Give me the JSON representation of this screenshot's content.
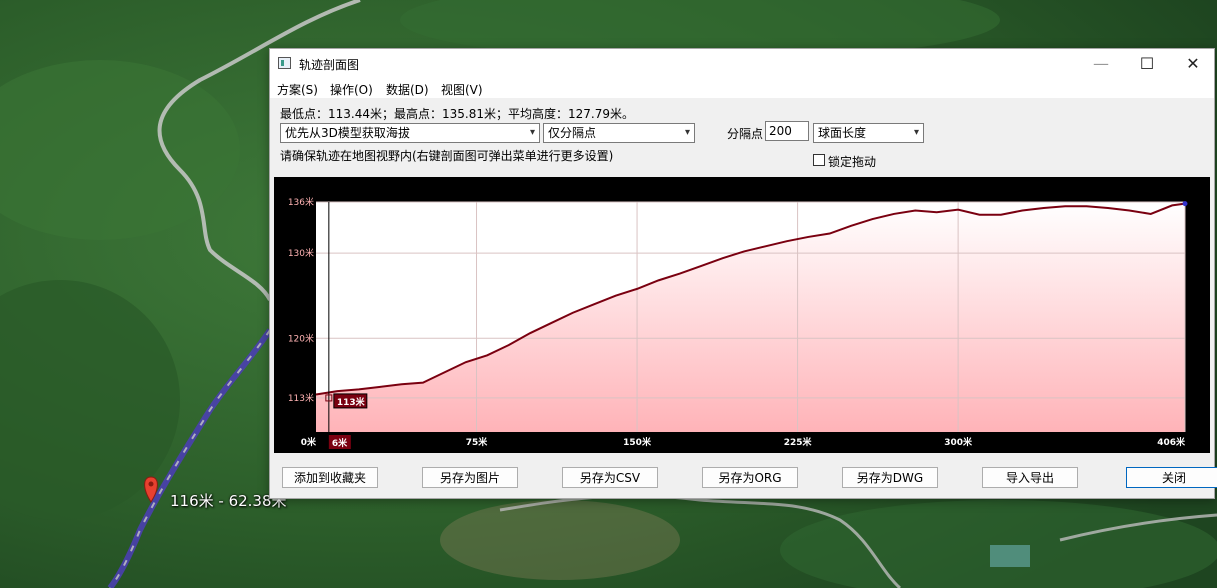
{
  "window": {
    "title": "轨迹剖面图",
    "minimize": "—",
    "maximize": "☐",
    "close": "✕"
  },
  "menu": [
    "方案(S)",
    "操作(O)",
    "数据(D)",
    "视图(V)"
  ],
  "stats_text": "最低点：113.44米；最高点：135.81米；平均高度：127.79米。",
  "controls": {
    "source_select": "优先从3D模型获取海拔",
    "mode_select": "仅分隔点",
    "interval_label": "分隔点",
    "interval_value": "200",
    "length_select": "球面长度",
    "hint": "请确保轨迹在地图视野内(右键剖面图可弹出菜单进行更多设置)",
    "lock_label": "锁定拖动",
    "lock_checked": false
  },
  "map": {
    "marker_label": "116米 - 62.38米"
  },
  "buttons": [
    "添加到收藏夹",
    "另存为图片",
    "另存为CSV",
    "另存为ORG",
    "另存为DWG",
    "导入导出",
    "关闭"
  ],
  "chart_data": {
    "type": "area",
    "x": [
      0,
      10,
      20,
      30,
      40,
      50,
      60,
      70,
      80,
      90,
      100,
      110,
      120,
      130,
      140,
      150,
      160,
      170,
      180,
      190,
      200,
      210,
      220,
      230,
      240,
      250,
      260,
      270,
      280,
      290,
      300,
      310,
      320,
      330,
      340,
      350,
      360,
      370,
      380,
      390,
      400,
      406
    ],
    "y": [
      113.4,
      113.8,
      114.0,
      114.3,
      114.6,
      114.8,
      116.0,
      117.2,
      118.0,
      119.2,
      120.6,
      121.8,
      123.0,
      124.0,
      125.0,
      125.8,
      126.8,
      127.6,
      128.5,
      129.4,
      130.2,
      130.8,
      131.4,
      131.9,
      132.3,
      133.2,
      134.0,
      134.6,
      135.0,
      134.8,
      135.1,
      134.5,
      134.5,
      135.0,
      135.3,
      135.5,
      135.5,
      135.3,
      135.0,
      134.6,
      135.6,
      135.81
    ],
    "x_ticks": [
      "0米",
      "75米",
      "150米",
      "225米",
      "300米",
      "406米"
    ],
    "x_tick_values": [
      0,
      75,
      150,
      225,
      300,
      406
    ],
    "y_ticks": [
      "113米",
      "120米",
      "130米",
      "136米"
    ],
    "y_tick_values": [
      113,
      120,
      130,
      136
    ],
    "xlim": [
      0,
      406
    ],
    "ylim": [
      109,
      136
    ],
    "cursor_x_label": "6米",
    "cursor_y_label": "113米",
    "cursor_x": 6,
    "cursor_y": 113,
    "line_color": "#7a0010",
    "fill_top_color": "#ffffff",
    "fill_bottom_color": "#ffb3b8",
    "grid": true
  }
}
